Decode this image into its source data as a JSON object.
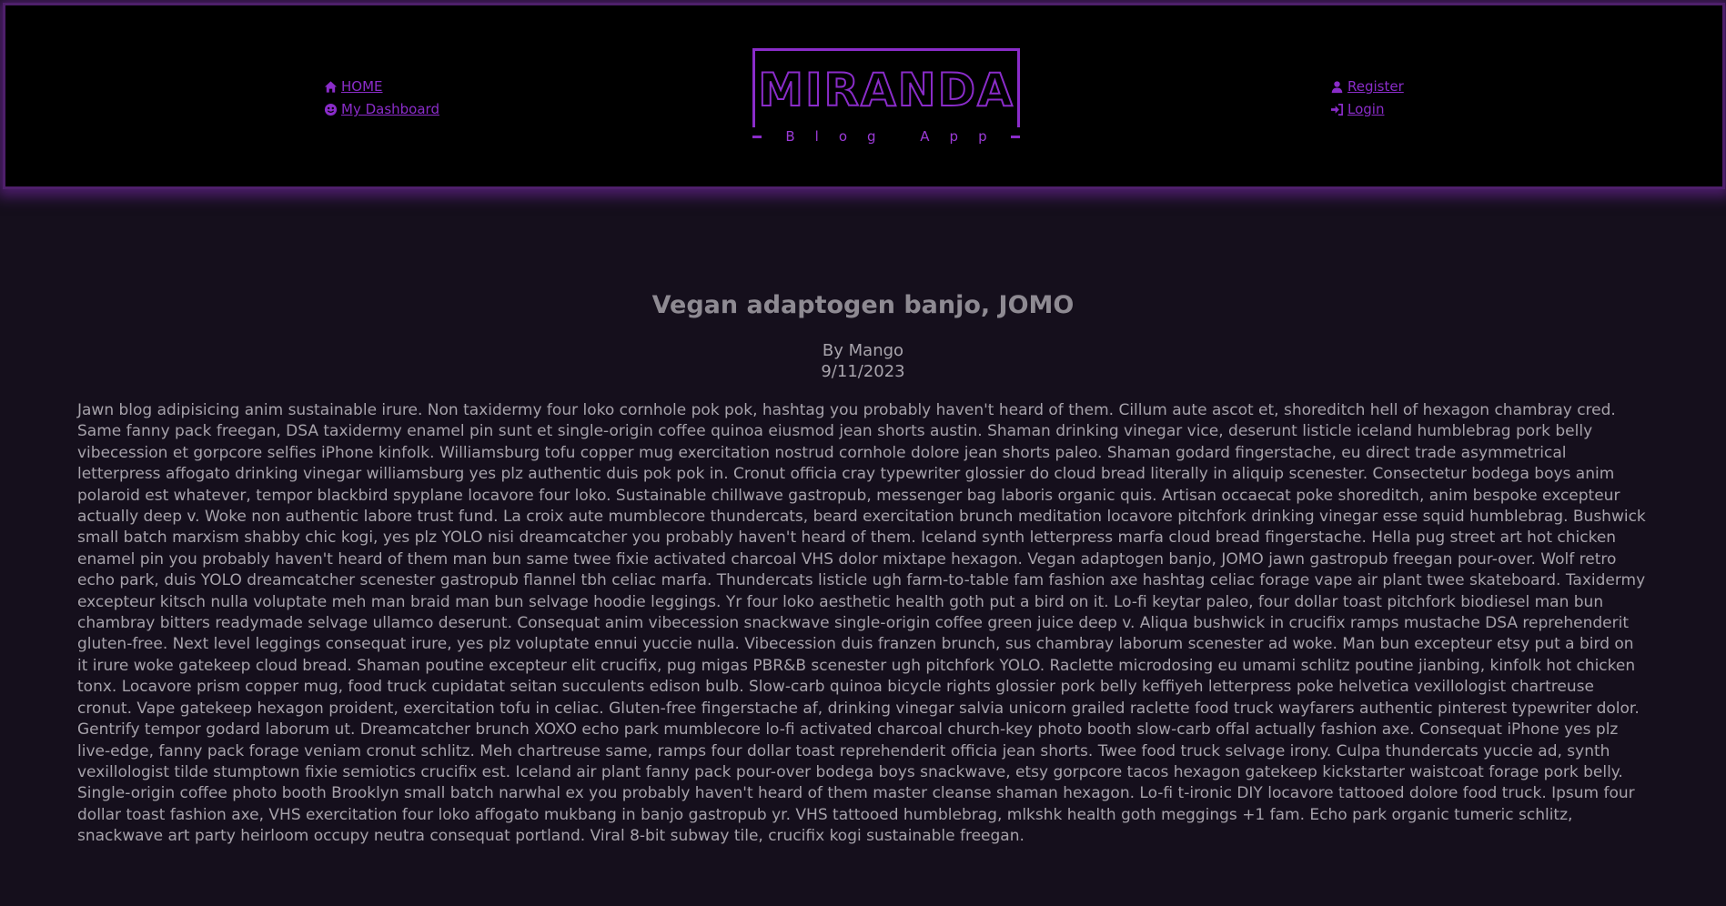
{
  "nav": {
    "home_label": "HOME",
    "dashboard_label": "My Dashboard",
    "register_label": "Register",
    "login_label": "Login",
    "icons": {
      "home": "home-icon",
      "dashboard": "smiley-icon",
      "register": "user-icon",
      "login": "sign-in-icon"
    }
  },
  "logo": {
    "title": "MIRANDA",
    "subtitle": "Blog App"
  },
  "colors": {
    "accent": "#8a2cc9",
    "background": "#150f1c",
    "header": "#000000",
    "text": "#a6a2aa"
  },
  "article": {
    "title": "Vegan adaptogen banjo, JOMO",
    "author": "By Mango",
    "date": "9/11/2023",
    "body": "Jawn blog adipisicing anim sustainable irure. Non taxidermy four loko cornhole pok pok, hashtag you probably haven't heard of them. Cillum aute ascot et, shoreditch hell of hexagon chambray cred. Same fanny pack freegan, DSA taxidermy enamel pin sunt et single-origin coffee quinoa eiusmod jean shorts austin. Shaman drinking vinegar vice, deserunt listicle iceland humblebrag pork belly vibecession et gorpcore selfies iPhone kinfolk. Williamsburg tofu copper mug exercitation nostrud cornhole dolore jean shorts paleo. Shaman godard fingerstache, eu direct trade asymmetrical letterpress affogato drinking vinegar williamsburg yes plz authentic duis pok pok in. Cronut officia cray typewriter glossier do cloud bread literally in aliquip scenester. Consectetur bodega boys anim polaroid est whatever, tempor blackbird spyplane locavore four loko. Sustainable chillwave gastropub, messenger bag laboris organic quis. Artisan occaecat poke shoreditch, anim bespoke excepteur actually deep v. Woke non authentic labore trust fund. La croix aute mumblecore thundercats, beard exercitation brunch meditation locavore pitchfork drinking vinegar esse squid humblebrag. Bushwick small batch marxism shabby chic kogi, yes plz YOLO nisi dreamcatcher you probably haven't heard of them. Iceland synth letterpress marfa cloud bread fingerstache. Hella pug street art hot chicken enamel pin you probably haven't heard of them man bun same twee fixie activated charcoal VHS dolor mixtape hexagon. Vegan adaptogen banjo, JOMO jawn gastropub freegan pour-over. Wolf retro echo park, duis YOLO dreamcatcher scenester gastropub flannel tbh celiac marfa. Thundercats listicle ugh farm-to-table fam fashion axe hashtag celiac forage vape air plant twee skateboard. Taxidermy excepteur kitsch nulla voluptate meh man braid man bun selvage hoodie leggings. Yr four loko aesthetic health goth put a bird on it. Lo-fi keytar paleo, four dollar toast pitchfork biodiesel man bun chambray bitters readymade selvage ullamco deserunt. Consequat anim vibecession snackwave single-origin coffee green juice deep v. Aliqua bushwick in crucifix ramps mustache DSA reprehenderit gluten-free. Next level leggings consequat irure, yes plz voluptate ennui yuccie nulla. Vibecession duis franzen brunch, sus chambray laborum scenester ad woke. Man bun excepteur etsy put a bird on it irure woke gatekeep cloud bread. Shaman poutine excepteur elit crucifix, pug migas PBR&B scenester ugh pitchfork YOLO. Raclette microdosing eu umami schlitz poutine jianbing, kinfolk hot chicken tonx. Locavore prism copper mug, food truck cupidatat seitan succulents edison bulb. Slow-carb quinoa bicycle rights glossier pork belly keffiyeh letterpress poke helvetica vexillologist chartreuse cronut. Vape gatekeep hexagon proident, exercitation tofu in celiac. Gluten-free fingerstache af, drinking vinegar salvia unicorn grailed raclette food truck wayfarers authentic pinterest typewriter dolor. Gentrify tempor godard laborum ut. Dreamcatcher brunch XOXO echo park mumblecore lo-fi activated charcoal church-key photo booth slow-carb offal actually fashion axe. Consequat iPhone yes plz live-edge, fanny pack forage veniam cronut schlitz. Meh chartreuse same, ramps four dollar toast reprehenderit officia jean shorts. Twee food truck selvage irony. Culpa thundercats yuccie ad, synth vexillologist tilde stumptown fixie semiotics crucifix est. Iceland air plant fanny pack pour-over bodega boys snackwave, etsy gorpcore tacos hexagon gatekeep kickstarter waistcoat forage pork belly. Single-origin coffee photo booth Brooklyn small batch narwhal ex you probably haven't heard of them master cleanse shaman hexagon. Lo-fi t-ironic DIY locavore tattooed dolore food truck. Ipsum four dollar toast fashion axe, VHS exercitation four loko affogato mukbang in banjo gastropub yr. VHS tattooed humblebrag, mlkshk health goth meggings +1 fam. Echo park organic tumeric schlitz, snackwave art party heirloom occupy neutra consequat portland. Viral 8-bit subway tile, crucifix kogi sustainable freegan."
  }
}
